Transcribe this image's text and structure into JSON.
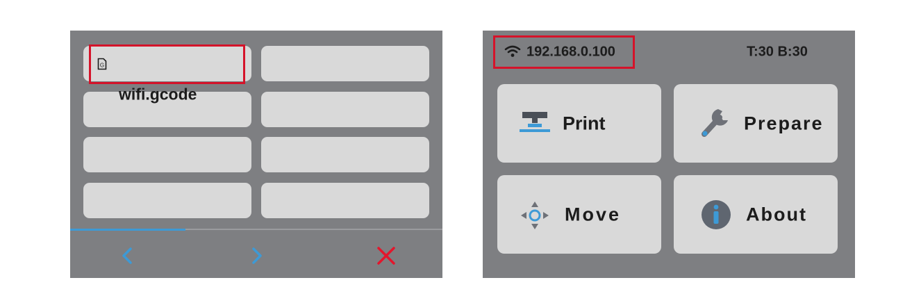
{
  "file_browser": {
    "file_name": "wifi.gcode",
    "file_icon_letter": "G",
    "slots_per_page": 8,
    "page_progress_fraction": 0.31,
    "nav": {
      "prev_icon": "chevron-left-icon",
      "next_icon": "chevron-right-icon",
      "close_icon": "close-icon"
    }
  },
  "main_menu": {
    "ip_address": "192.168.0.100",
    "temperature": "T:30 B:30",
    "buttons": {
      "print": "Print",
      "prepare": "Prepare",
      "move": "Move",
      "about": "About"
    }
  },
  "colors": {
    "screen_bg": "#7e7f82",
    "button_bg": "#d9d9d9",
    "accent_blue": "#3d9ad6",
    "highlight_red": "#d5132a",
    "close_red": "#e3162c"
  }
}
